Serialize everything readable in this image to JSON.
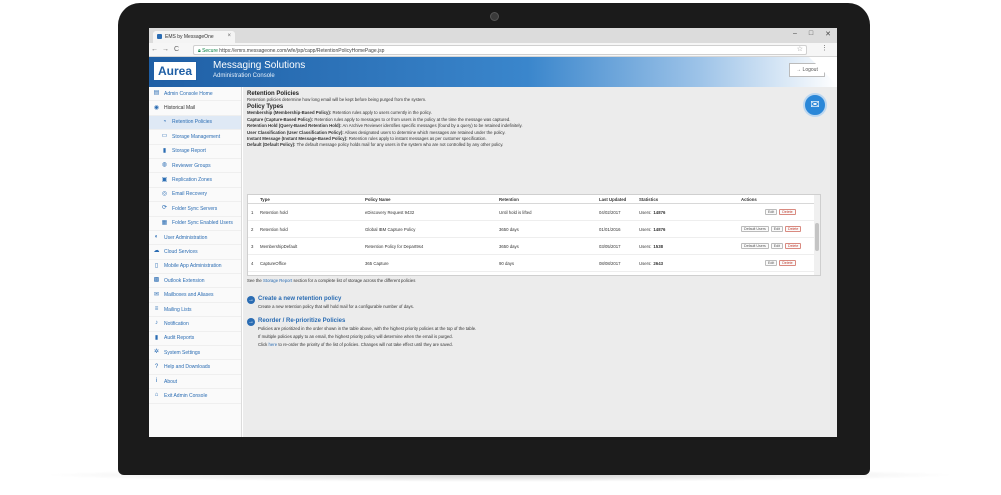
{
  "browser": {
    "tab_title": "EMS by MessageOne",
    "tab_close": "×",
    "win_min": "–",
    "win_max": "□",
    "win_close": "✕",
    "back": "←",
    "forward": "→",
    "reload": "C",
    "secure_label": "Secure",
    "url": "https://emrs.messageone.com/wfe/jsp/capp/RetentionPolicyHomePage.jsp",
    "star": "☆",
    "menu": "⋮"
  },
  "header": {
    "logo": "Aurea",
    "title": "Messaging Solutions",
    "subtitle": "Administration Console",
    "logout": "Logout"
  },
  "sidebar": {
    "items": [
      {
        "label": "Admin Console Home",
        "icon": "home-icon",
        "glyph": "▤"
      },
      {
        "label": "Historical Mail",
        "icon": "archive-icon",
        "glyph": "◉"
      },
      {
        "label": "Retention Policies",
        "icon": "clock-icon",
        "glyph": "◔"
      },
      {
        "label": "Storage Management",
        "icon": "storage-icon",
        "glyph": "▭"
      },
      {
        "label": "Storage Report",
        "icon": "bar-chart-icon",
        "glyph": "▮"
      },
      {
        "label": "Reviewer Groups",
        "icon": "users-icon",
        "glyph": "◍"
      },
      {
        "label": "Replication Zones",
        "icon": "replicate-icon",
        "glyph": "▣"
      },
      {
        "label": "Email Recovery",
        "icon": "recovery-icon",
        "glyph": "◎"
      },
      {
        "label": "Folder Sync Servers",
        "icon": "sync-icon",
        "glyph": "⟳"
      },
      {
        "label": "Folder Sync Enabled Users",
        "icon": "user-sync-icon",
        "glyph": "▦"
      },
      {
        "label": "User Administration",
        "icon": "user-admin-icon",
        "glyph": "◐"
      },
      {
        "label": "Cloud Services",
        "icon": "cloud-icon",
        "glyph": "☁"
      },
      {
        "label": "Mobile App Administration",
        "icon": "mobile-icon",
        "glyph": "▯"
      },
      {
        "label": "Outlook Extension",
        "icon": "outlook-icon",
        "glyph": "▩"
      },
      {
        "label": "Mailboxes and Aliases",
        "icon": "mailbox-icon",
        "glyph": "✉"
      },
      {
        "label": "Mailing Lists",
        "icon": "list-icon",
        "glyph": "≡"
      },
      {
        "label": "Notification",
        "icon": "bell-icon",
        "glyph": "♪"
      },
      {
        "label": "Audit Reports",
        "icon": "audit-chart-icon",
        "glyph": "▮"
      },
      {
        "label": "System Settings",
        "icon": "gear-icon",
        "glyph": "✲"
      },
      {
        "label": "Help and Downloads",
        "icon": "help-icon",
        "glyph": "?"
      },
      {
        "label": "About",
        "icon": "info-icon",
        "glyph": "i"
      },
      {
        "label": "Exit Admin Console",
        "icon": "exit-icon",
        "glyph": "⌂"
      }
    ]
  },
  "main": {
    "title": "Retention Policies",
    "intro": "Retention policies determine how long email will be kept before being purged from the system.",
    "types_title": "Policy Types",
    "definitions": [
      {
        "term": "Membership (Membership-Based Policy):",
        "text": " Retention rules apply to users currently in the policy."
      },
      {
        "term": "Capture (Capture-Based Policy):",
        "text": " Retention rules apply to messages to or from users in the policy at the time the message was captured."
      },
      {
        "term": "Retention Hold (Query-Based Retention Hold):",
        "text": " An Archive Reviewer identifies specific messages (found by a query) to be retained indefinitely."
      },
      {
        "term": "User Classification (User Classification Policy):",
        "text": " Allows designated users to determine which messages are retained under the policy."
      },
      {
        "term": "Instant Message (Instant Message-Based Policy):",
        "text": " Retention rules apply to instant messages as per customer specification."
      },
      {
        "term": "Default (Default Policy):",
        "text": " The default message policy holds mail for any users in the system who are not controlled by any other policy."
      }
    ],
    "table": {
      "headers": {
        "type": "Type",
        "name": "Policy Name",
        "retention": "Retention",
        "updated": "Last Updated",
        "stats": "Statistics",
        "actions": "Actions"
      },
      "rows": [
        {
          "num": "1",
          "type": "Retention hold",
          "name": "eDiscovery Request 9432",
          "retention": "Until hold is lifted",
          "updated": "04/02/2017",
          "stats_label": "Users:",
          "stats_value": "14876"
        },
        {
          "num": "2",
          "type": "Retention hold",
          "name": "Global IBM Capture Policy",
          "retention": "3650 days",
          "updated": "01/01/2016",
          "stats_label": "Users:",
          "stats_value": "14876"
        },
        {
          "num": "3",
          "type": "MembershipDefault",
          "name": "Retention Policy for Depart9s4",
          "retention": "3650 days",
          "updated": "03/05/2017",
          "stats_label": "Users:",
          "stats_value": "1538"
        },
        {
          "num": "4",
          "type": "CaptureOffice",
          "name": "365 Capture",
          "retention": "90 days",
          "updated": "08/08/2017",
          "stats_label": "Users:",
          "stats_value": "2643"
        }
      ],
      "btn_default": "Default Users",
      "btn_edit": "Edit",
      "btn_delete": "Delete"
    },
    "note_pre": "See the",
    "note_link": "Storage Report",
    "note_post": "section for a complete list of storage across the different policies",
    "create_title": "Create a new retention policy",
    "create_body": "Create a new retention policy that will hold mail for a configurable number of days.",
    "reorder_title": "Reorder / Re-prioritize Policies",
    "reorder_body_1": "Policies are prioritized in the order shown in the table above, with the highest priority policies at the top of the table.",
    "reorder_body_2": "If multiple policies apply to an email, the highest priority policy will determine when the email is purged.",
    "reorder_click": "Click",
    "reorder_here": "here",
    "reorder_body_3": "to re-order the priority of the list of policies. Changes will not take effect until they are saved."
  },
  "colors": {
    "accent": "#2a6cb3",
    "delete": "#c0392b"
  }
}
